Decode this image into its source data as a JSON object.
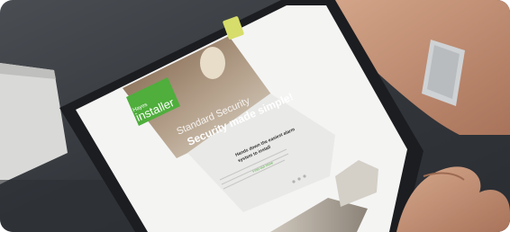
{
  "photo": {
    "subject": "tablet-held-in-hands",
    "colors": {
      "background_dark": "#3b3f44",
      "tablet_bezel": "#1c1d20",
      "screen_white": "#f4f4f3",
      "brand_green": "#4fae3c",
      "skin": "#c9967a"
    }
  },
  "screen": {
    "logo_line1": "Hayes",
    "logo_line2": "installer",
    "hero_overlay_1": "Standard Security",
    "hero_headline": "Security made simple!",
    "panel_heading_1": "Hands down the easiest alarm",
    "panel_heading_2": "system to install",
    "panel_link": "Find out more"
  }
}
